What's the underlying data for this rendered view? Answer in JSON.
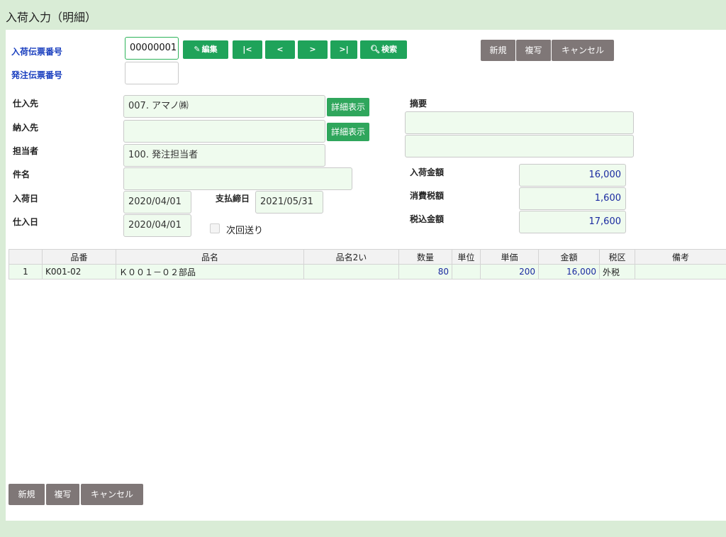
{
  "page_title": "入荷入力（明細）",
  "labels": {
    "arrival_slip_no": "入荷伝票番号",
    "order_slip_no": "発注伝票番号",
    "supplier": "仕入先",
    "delivery_dest": "納入先",
    "person": "担当者",
    "subject": "件名",
    "arrival_date": "入荷日",
    "payment_close_date": "支払締日",
    "purchase_date": "仕入日",
    "summary": "摘要",
    "arrival_amount": "入荷金額",
    "consumption_tax": "消費税額",
    "tax_included": "税込金額",
    "next_send": "次回送り"
  },
  "fields": {
    "arrival_slip_no": "00000001",
    "order_slip_no": "",
    "supplier": "007. アマノ㈱",
    "delivery_dest": "",
    "person": "100. 発注担当者",
    "subject": "",
    "arrival_date": "2020/04/01",
    "payment_close_date": "2021/05/31",
    "purchase_date": "2020/04/01",
    "summary1": "",
    "summary2": "",
    "arrival_amount": "16,000",
    "consumption_tax": "1,600",
    "tax_included": "17,600"
  },
  "nav": {
    "edit": "編集",
    "first": "|<",
    "prev": "<",
    "next": ">",
    "last": ">|",
    "search": "検索",
    "edit_icon": "edit-icon",
    "search_icon": "search-icon"
  },
  "detail_button": "詳細表示",
  "actions": {
    "new": "新規",
    "copy": "複写",
    "cancel": "キャンセル"
  },
  "table": {
    "headers": [
      "",
      "品番",
      "品名",
      "品名2い",
      "数量",
      "単位",
      "単価",
      "金額",
      "税区",
      "備考"
    ],
    "rows": [
      {
        "no": "1",
        "code": "K001-02",
        "name": "Ｋ００１－０２部品",
        "name2": "",
        "qty": "80",
        "unit": "",
        "price": "200",
        "amount": "16,000",
        "tax": "外税",
        "note": ""
      }
    ]
  },
  "colors": {
    "accent": "#1fa35a",
    "background": "#d9ecd6",
    "button_gray": "#7f7777",
    "label_blue": "#1a3fbf"
  }
}
